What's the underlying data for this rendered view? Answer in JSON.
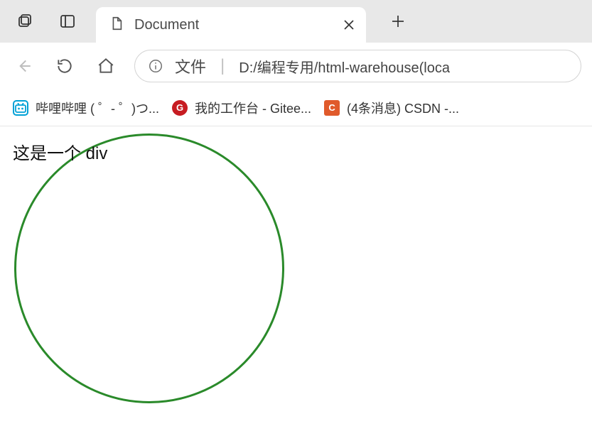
{
  "tabbar": {
    "tab_title": "Document"
  },
  "addressbar": {
    "scheme_label": "文件",
    "url": "D:/编程专用/html-warehouse(loca"
  },
  "bookmarks": [
    {
      "label": "哔哩哔哩 ( ゜- ゜)つ..."
    },
    {
      "label": "我的工作台 - Gitee..."
    },
    {
      "label": "(4条消息) CSDN -..."
    }
  ],
  "page": {
    "demo_text": "这是一个 div"
  }
}
